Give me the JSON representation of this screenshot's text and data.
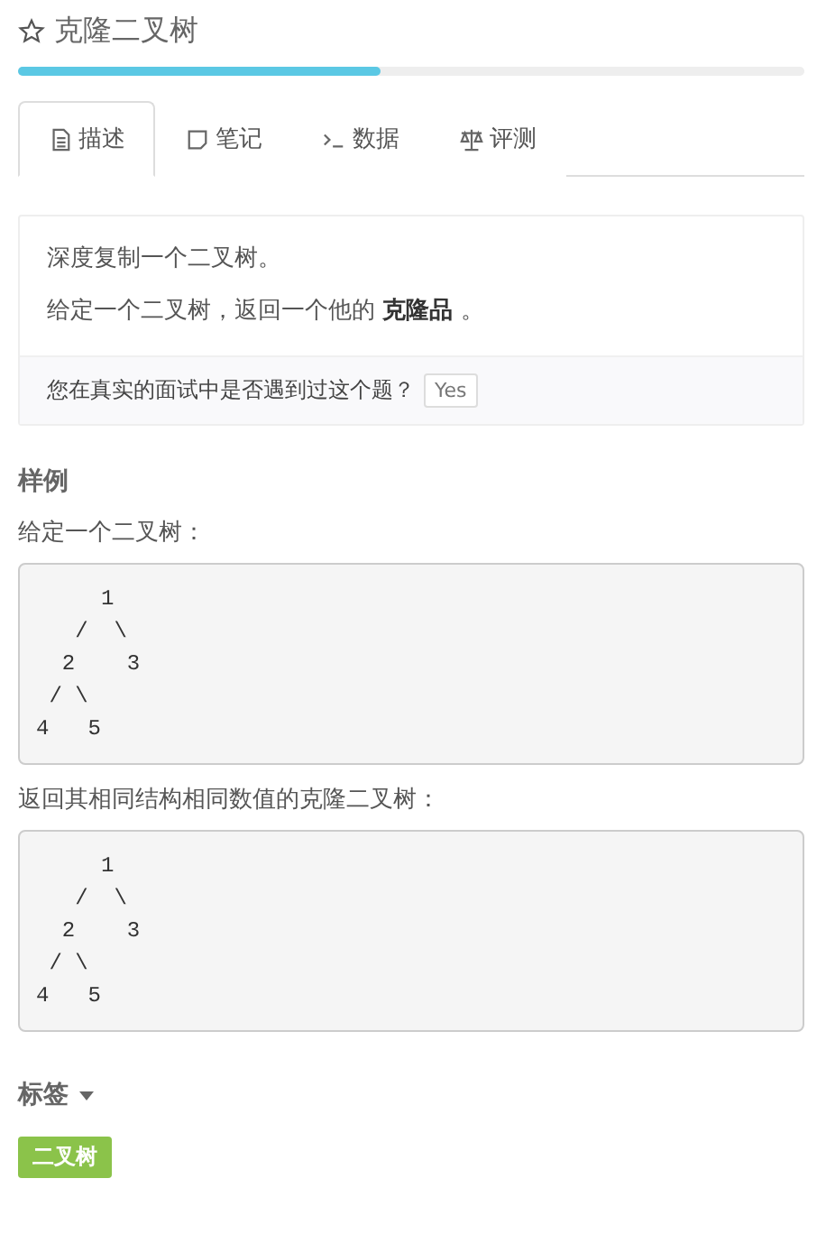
{
  "title": "克隆二叉树",
  "progress": {
    "level": 0.46
  },
  "tabs": [
    {
      "label": "描述",
      "kind": "doc",
      "selected": true
    },
    {
      "label": "笔记",
      "kind": "note",
      "selected": false
    },
    {
      "label": "数据",
      "kind": "terminal",
      "selected": false
    },
    {
      "label": "评测",
      "kind": "scale",
      "selected": false
    }
  ],
  "description": {
    "paragraphs": [
      "深度复制一个二叉树。",
      "给定一个二叉树，返回一个他的 **克隆品** 。"
    ],
    "question": "您在真实的面试中是否遇到过这个题？",
    "answer_button": "Yes"
  },
  "example": {
    "heading": "样例",
    "blocks": [
      {
        "caption": "给定一个二叉树：",
        "code": "     1\n   /  \\\n  2    3\n / \\\n4   5"
      },
      {
        "caption": "返回其相同结构相同数值的克隆二叉树：",
        "code": "     1\n   /  \\\n  2    3\n / \\\n4   5"
      }
    ]
  },
  "tags": {
    "heading": "标签",
    "items": [
      "二叉树"
    ]
  }
}
